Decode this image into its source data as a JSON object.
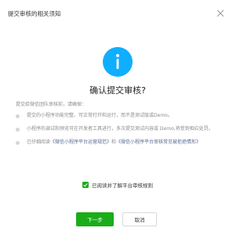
{
  "dialog": {
    "header_title": "提交审核的相关须知",
    "close_icon": "close-icon",
    "info_icon": "info-icon",
    "main_title": "确认提交审核?",
    "intro": "提交给微信团队审核前，请确保：",
    "notices": [
      {
        "text": "提交的小程序功能完整、可正常打开和运行，而不是测试版或Demo。"
      },
      {
        "text": "小程序的调试和预览可在开发者工具进行，多次提交测试内容或 Demo,将受到相应处罚。"
      },
      {
        "prefix": "已仔细阅读",
        "link1": "《微信小程序平台运营规范》",
        "middle": "和",
        "link2": "《微信小程序平台审核常见被拒绝情形》"
      }
    ],
    "agree_label": "已阅读并了解平台审核规则",
    "agree_checked": true,
    "next_button": "下一步",
    "cancel_button": "取消",
    "colors": {
      "primary": "#1aad19",
      "info": "#10aeff",
      "link": "#576b95"
    }
  }
}
